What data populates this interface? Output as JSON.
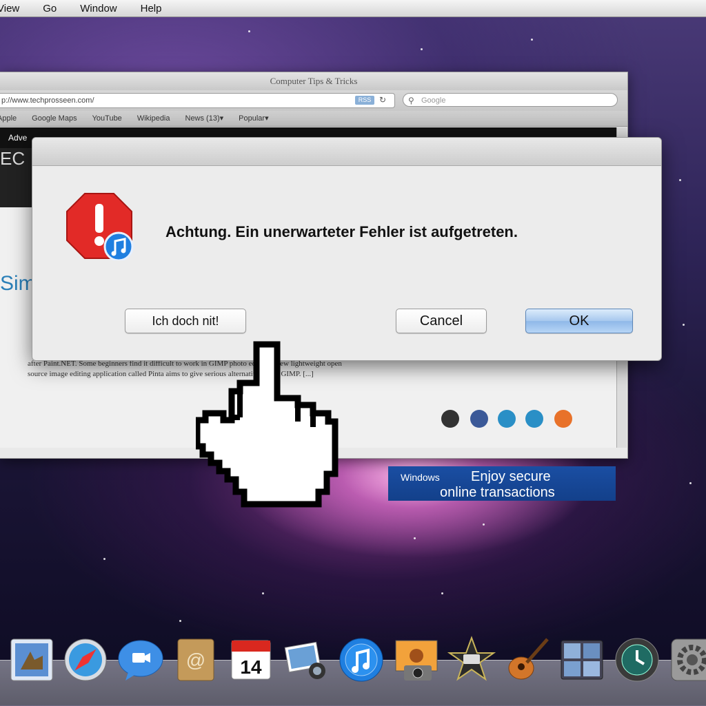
{
  "menubar": {
    "items": [
      "View",
      "Go",
      "Window",
      "Help"
    ]
  },
  "browser": {
    "title": "Computer Tips & Tricks",
    "url": "p://www.techprosseen.com/",
    "rss": "RSS",
    "search_placeholder": "Google",
    "bookmarks": [
      "Apple",
      "Google Maps",
      "YouTube",
      "Wikipedia",
      "News (13)▾",
      "Popular▾"
    ],
    "nav_text": "Adve",
    "page_big_text": "Sim",
    "brand_fragment": "EC",
    "article_text": "after Paint.NET. Some beginners find it difficult to work in GIMP photo editor. A new lightweight open source image editing application called Pinta aims to give serious alternative to the GIMP. [...]",
    "ad_windows": "Windows",
    "ad_line1": "Enjoy secure",
    "ad_line2": "online transactions"
  },
  "dialog": {
    "message": "Achtung. Ein unerwarteter Fehler ist aufgetreten.",
    "buttons": {
      "ich": "Ich doch nit!",
      "cancel": "Cancel",
      "ok": "OK"
    }
  },
  "dock": {
    "calendar_day": "14",
    "items": [
      "preview-icon",
      "safari-icon",
      "ichat-icon",
      "address-book-icon",
      "ical-icon",
      "iphoto-icon",
      "itunes-icon",
      "photo-booth-icon",
      "imovie-icon",
      "garageband-icon",
      "spaces-icon",
      "time-machine-icon",
      "system-preferences-icon"
    ]
  },
  "colors": {
    "stop_red": "#e22a27",
    "itunes_blue": "#1f7fe0",
    "ok_button_blue": "#8fb8e8"
  }
}
